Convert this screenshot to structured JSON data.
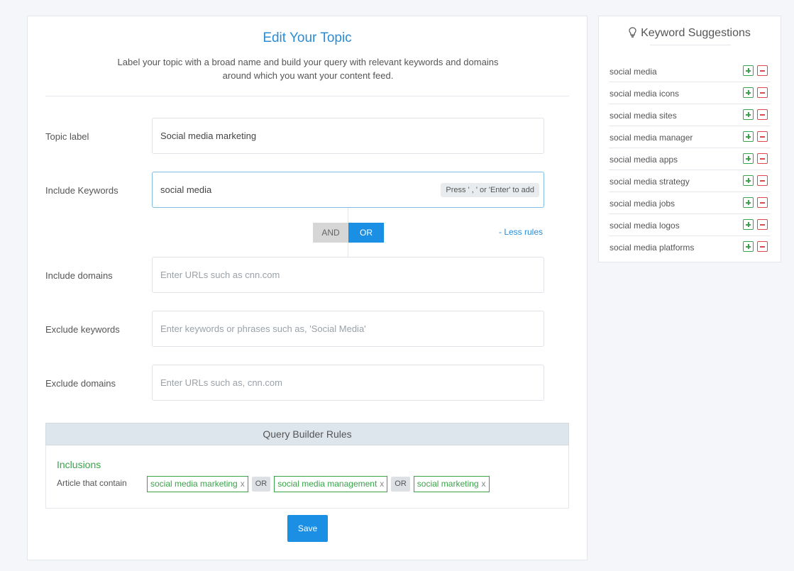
{
  "header": {
    "title": "Edit Your Topic",
    "description": "Label your topic with a broad name and build your query with relevant keywords and domains around which you want your content feed."
  },
  "form": {
    "topic_label": {
      "label": "Topic label",
      "value": "Social media marketing"
    },
    "include_keywords": {
      "label": "Include Keywords",
      "value": "social media",
      "hint": "Press ' , ' or 'Enter' to add"
    },
    "operator": {
      "and_label": "AND",
      "or_label": "OR",
      "selected": "OR"
    },
    "less_rules": "- Less rules",
    "include_domains": {
      "label": "Include domains",
      "placeholder": "Enter URLs such as cnn.com"
    },
    "exclude_keywords": {
      "label": "Exclude keywords",
      "placeholder": "Enter keywords or phrases such as, 'Social Media'"
    },
    "exclude_domains": {
      "label": "Exclude domains",
      "placeholder": "Enter URLs such as, cnn.com"
    }
  },
  "query_builder": {
    "title": "Query Builder Rules",
    "inclusions_title": "Inclusions",
    "article_label": "Article that contain",
    "chips": [
      "social media marketing",
      "social media management",
      "social marketing"
    ],
    "chip_remove": "x",
    "joiner": "OR"
  },
  "save_label": "Save",
  "suggestions": {
    "title": "Keyword Suggestions",
    "items": [
      "social media",
      "social media icons",
      "social media sites",
      "social media manager",
      "social media apps",
      "social media strategy",
      "social media jobs",
      "social media logos",
      "social media platforms"
    ]
  },
  "colors": {
    "accent": "#2b8cd6",
    "primary_button": "#1a8fe3",
    "success": "#3aa34a",
    "danger": "#e0474c"
  }
}
